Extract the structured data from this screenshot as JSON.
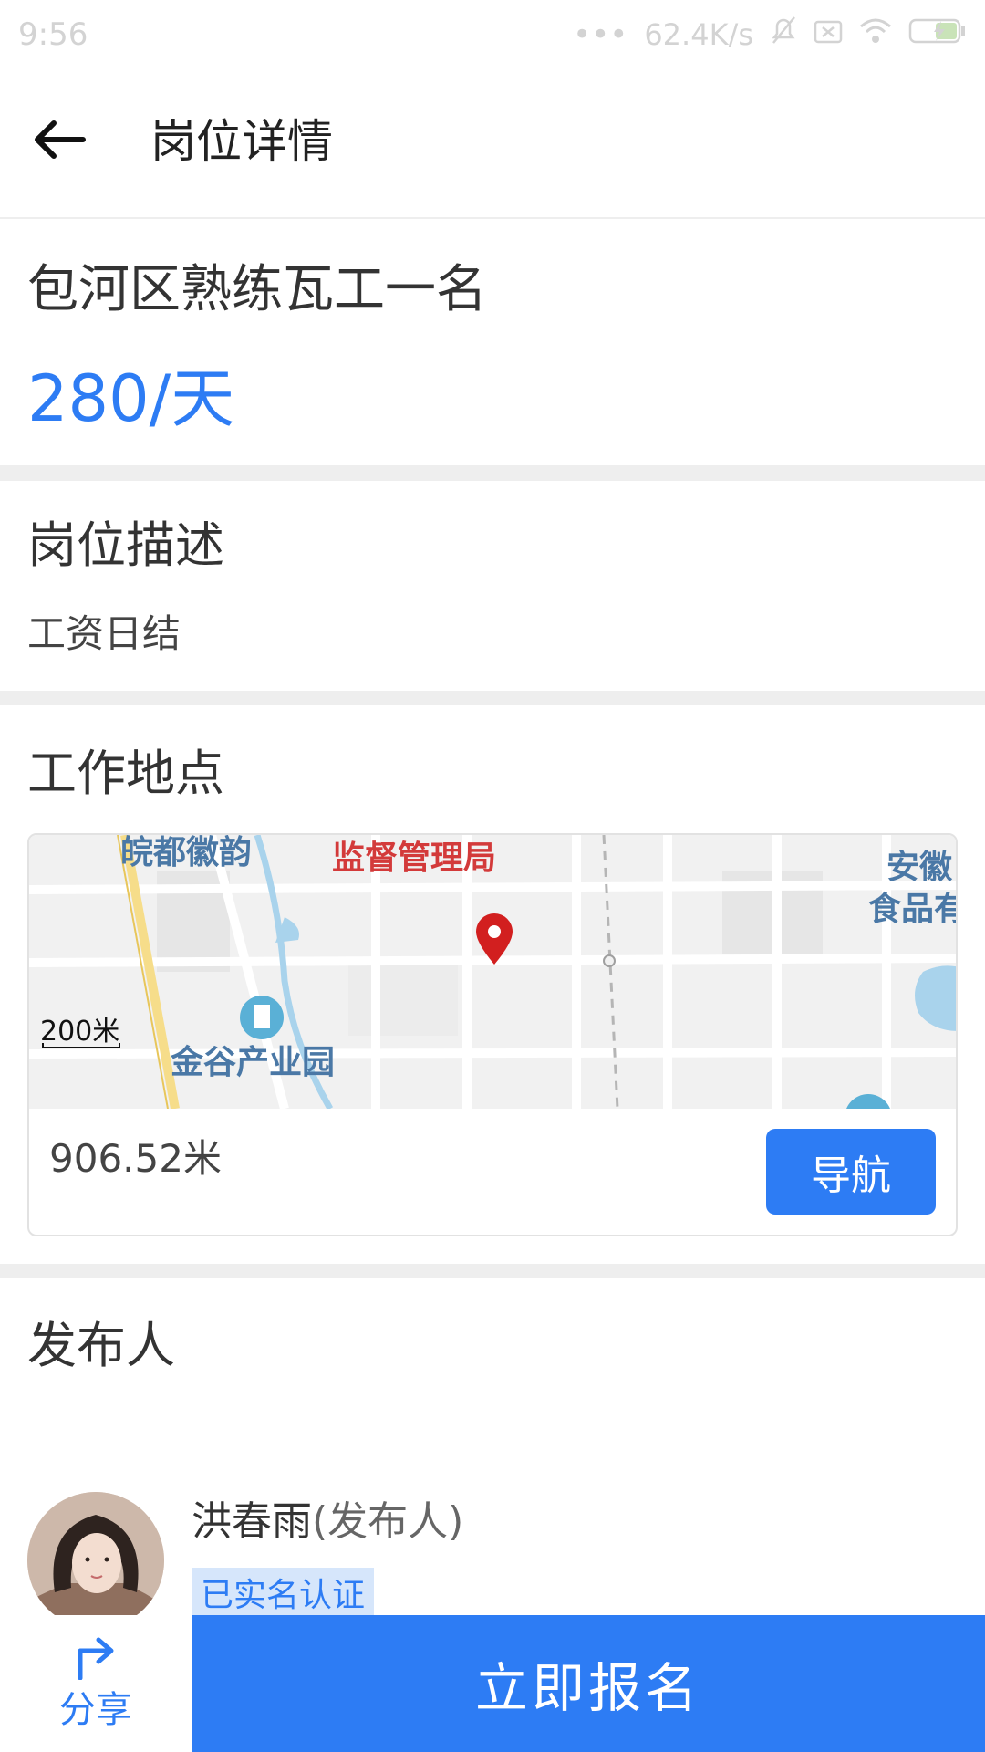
{
  "status_bar": {
    "time": "9:56",
    "network_speed": "62.4K/s"
  },
  "header": {
    "back_icon": "arrow-left-icon",
    "title": "岗位详情"
  },
  "job": {
    "title": "包河区熟练瓦工一名",
    "salary": "280/天"
  },
  "description": {
    "heading": "岗位描述",
    "text": "工资日结"
  },
  "location": {
    "heading": "工作地点",
    "map": {
      "labels": {
        "wandu": "皖都徽韵",
        "jiandu": "监督管理局",
        "anhui_1": "安徽",
        "anhui_2": "食品有",
        "jingu": "金谷产业园"
      },
      "scale": "200米",
      "marker_icon": "map-pin-icon"
    },
    "distance": "906.52米",
    "nav_label": "导航"
  },
  "publisher": {
    "heading": "发布人",
    "name": "洪春雨",
    "role": "(发布人)",
    "verified": "已实名认证"
  },
  "bottom": {
    "share_label": "分享",
    "apply_label": "立即报名"
  },
  "colors": {
    "accent": "#2d7cf4",
    "map_red_label": "#d33a3a",
    "map_blue_label": "#4a78a6",
    "divider": "#eeeeee"
  }
}
